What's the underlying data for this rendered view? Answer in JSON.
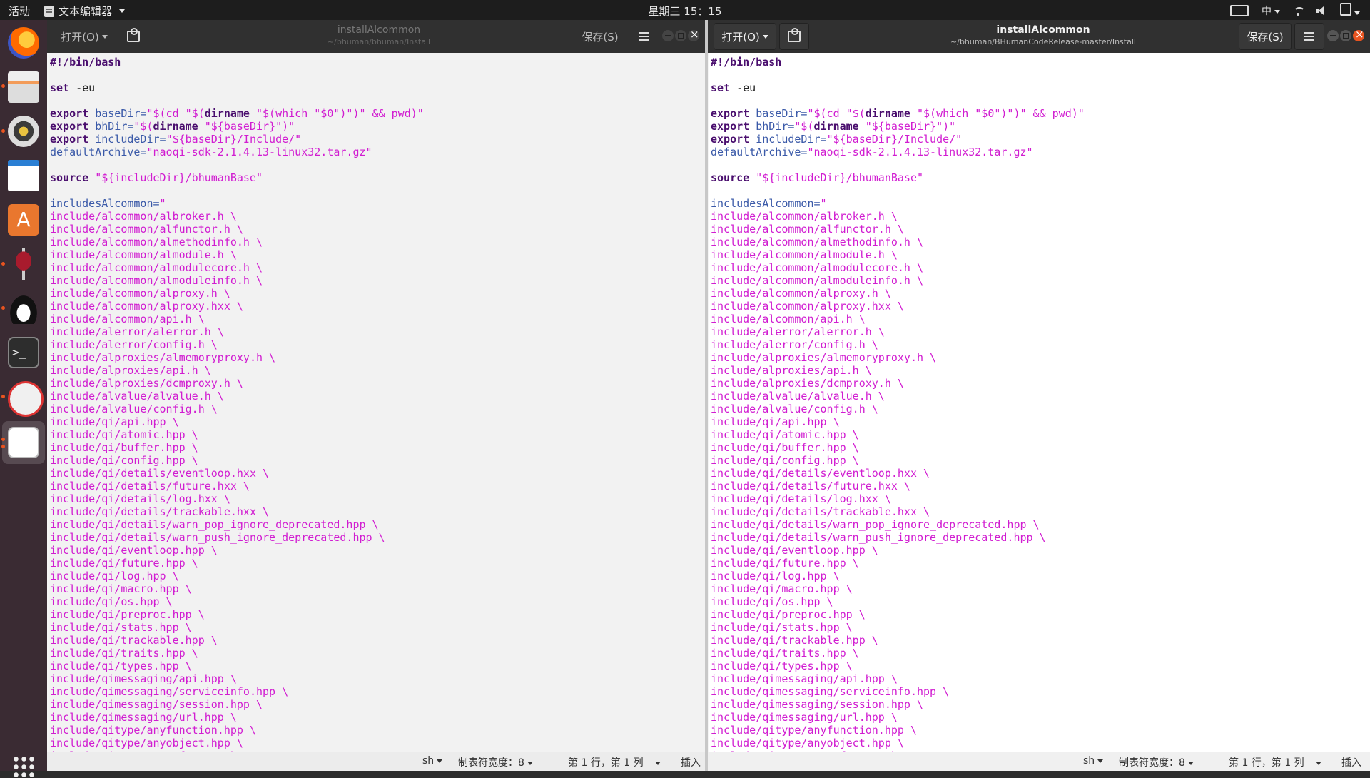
{
  "topbar": {
    "activities": "活动",
    "app_name": "文本编辑器",
    "clock": "星期三 15：15",
    "input_method": "中"
  },
  "dock": {
    "apps": [
      "firefox",
      "files",
      "rhythmbox",
      "libreoffice-writer",
      "software-center",
      "wine",
      "qq",
      "terminal",
      "xplayer",
      "text-editor",
      "show-apps"
    ]
  },
  "left_window": {
    "title": "installAlcommon",
    "path": "~/bhuman/bhuman/Install",
    "open_label": "打开(O)",
    "save_label": "保存(S)",
    "status": {
      "language": "sh",
      "tab_width": "制表符宽度：8",
      "position": "第 1 行，第 1 列",
      "mode": "插入"
    }
  },
  "right_window": {
    "title": "installAlcommon",
    "path": "~/bhuman/BHumanCodeRelease-master/Install",
    "open_label": "打开(O)",
    "save_label": "保存(S)",
    "status": {
      "language": "sh",
      "tab_width": "制表符宽度：8",
      "position": "第 1 行，第 1 列",
      "mode": "插入"
    }
  },
  "code_lines": [
    [
      {
        "t": "#!/bin/bash",
        "c": "kw"
      }
    ],
    [],
    [
      {
        "t": "set",
        "c": "kw"
      },
      {
        "t": " -eu",
        "c": "plain"
      }
    ],
    [],
    [
      {
        "t": "export",
        "c": "kw"
      },
      {
        "t": " baseDir=",
        "c": "var"
      },
      {
        "t": "\"$(cd \"$(",
        "c": "str"
      },
      {
        "t": "dirname",
        "c": "kw"
      },
      {
        "t": " \"$(which \"$0\")\")\" && pwd)\"",
        "c": "str"
      }
    ],
    [
      {
        "t": "export",
        "c": "kw"
      },
      {
        "t": " bhDir=",
        "c": "var"
      },
      {
        "t": "\"$(",
        "c": "str"
      },
      {
        "t": "dirname",
        "c": "kw"
      },
      {
        "t": " \"${baseDir}\")\"",
        "c": "str"
      }
    ],
    [
      {
        "t": "export",
        "c": "kw"
      },
      {
        "t": " includeDir=",
        "c": "var"
      },
      {
        "t": "\"${baseDir}/Include/\"",
        "c": "str"
      }
    ],
    [
      {
        "t": "defaultArchive=",
        "c": "var"
      },
      {
        "t": "\"naoqi-sdk-2.1.4.13-linux32.tar.gz\"",
        "c": "str"
      }
    ],
    [],
    [
      {
        "t": "source",
        "c": "kw"
      },
      {
        "t": " \"${includeDir}/bhumanBase\"",
        "c": "str"
      }
    ],
    [],
    [
      {
        "t": "includesAlcommon=",
        "c": "var"
      },
      {
        "t": "\"",
        "c": "str"
      }
    ],
    [
      {
        "t": "include/alcommon/albroker.h \\",
        "c": "str"
      }
    ],
    [
      {
        "t": "include/alcommon/alfunctor.h \\",
        "c": "str"
      }
    ],
    [
      {
        "t": "include/alcommon/almethodinfo.h \\",
        "c": "str"
      }
    ],
    [
      {
        "t": "include/alcommon/almodule.h \\",
        "c": "str"
      }
    ],
    [
      {
        "t": "include/alcommon/almodulecore.h \\",
        "c": "str"
      }
    ],
    [
      {
        "t": "include/alcommon/almoduleinfo.h \\",
        "c": "str"
      }
    ],
    [
      {
        "t": "include/alcommon/alproxy.h \\",
        "c": "str"
      }
    ],
    [
      {
        "t": "include/alcommon/alproxy.hxx \\",
        "c": "str"
      }
    ],
    [
      {
        "t": "include/alcommon/api.h \\",
        "c": "str"
      }
    ],
    [
      {
        "t": "include/alerror/alerror.h \\",
        "c": "str"
      }
    ],
    [
      {
        "t": "include/alerror/config.h \\",
        "c": "str"
      }
    ],
    [
      {
        "t": "include/alproxies/almemoryproxy.h \\",
        "c": "str"
      }
    ],
    [
      {
        "t": "include/alproxies/api.h \\",
        "c": "str"
      }
    ],
    [
      {
        "t": "include/alproxies/dcmproxy.h \\",
        "c": "str"
      }
    ],
    [
      {
        "t": "include/alvalue/alvalue.h \\",
        "c": "str"
      }
    ],
    [
      {
        "t": "include/alvalue/config.h \\",
        "c": "str"
      }
    ],
    [
      {
        "t": "include/qi/api.hpp \\",
        "c": "str"
      }
    ],
    [
      {
        "t": "include/qi/atomic.hpp \\",
        "c": "str"
      }
    ],
    [
      {
        "t": "include/qi/buffer.hpp \\",
        "c": "str"
      }
    ],
    [
      {
        "t": "include/qi/config.hpp \\",
        "c": "str"
      }
    ],
    [
      {
        "t": "include/qi/details/eventloop.hxx \\",
        "c": "str"
      }
    ],
    [
      {
        "t": "include/qi/details/future.hxx \\",
        "c": "str"
      }
    ],
    [
      {
        "t": "include/qi/details/log.hxx \\",
        "c": "str"
      }
    ],
    [
      {
        "t": "include/qi/details/trackable.hxx \\",
        "c": "str"
      }
    ],
    [
      {
        "t": "include/qi/details/warn_pop_ignore_deprecated.hpp \\",
        "c": "str"
      }
    ],
    [
      {
        "t": "include/qi/details/warn_push_ignore_deprecated.hpp \\",
        "c": "str"
      }
    ],
    [
      {
        "t": "include/qi/eventloop.hpp \\",
        "c": "str"
      }
    ],
    [
      {
        "t": "include/qi/future.hpp \\",
        "c": "str"
      }
    ],
    [
      {
        "t": "include/qi/log.hpp \\",
        "c": "str"
      }
    ],
    [
      {
        "t": "include/qi/macro.hpp \\",
        "c": "str"
      }
    ],
    [
      {
        "t": "include/qi/os.hpp \\",
        "c": "str"
      }
    ],
    [
      {
        "t": "include/qi/preproc.hpp \\",
        "c": "str"
      }
    ],
    [
      {
        "t": "include/qi/stats.hpp \\",
        "c": "str"
      }
    ],
    [
      {
        "t": "include/qi/trackable.hpp \\",
        "c": "str"
      }
    ],
    [
      {
        "t": "include/qi/traits.hpp \\",
        "c": "str"
      }
    ],
    [
      {
        "t": "include/qi/types.hpp \\",
        "c": "str"
      }
    ],
    [
      {
        "t": "include/qimessaging/api.hpp \\",
        "c": "str"
      }
    ],
    [
      {
        "t": "include/qimessaging/serviceinfo.hpp \\",
        "c": "str"
      }
    ],
    [
      {
        "t": "include/qimessaging/session.hpp \\",
        "c": "str"
      }
    ],
    [
      {
        "t": "include/qimessaging/url.hpp \\",
        "c": "str"
      }
    ],
    [
      {
        "t": "include/qitype/anyfunction.hpp \\",
        "c": "str"
      }
    ],
    [
      {
        "t": "include/qitype/anyobject.hpp \\",
        "c": "str"
      }
    ],
    [
      {
        "t": "include/qitype/anyreference.hpp \\",
        "c": "str"
      }
    ]
  ]
}
